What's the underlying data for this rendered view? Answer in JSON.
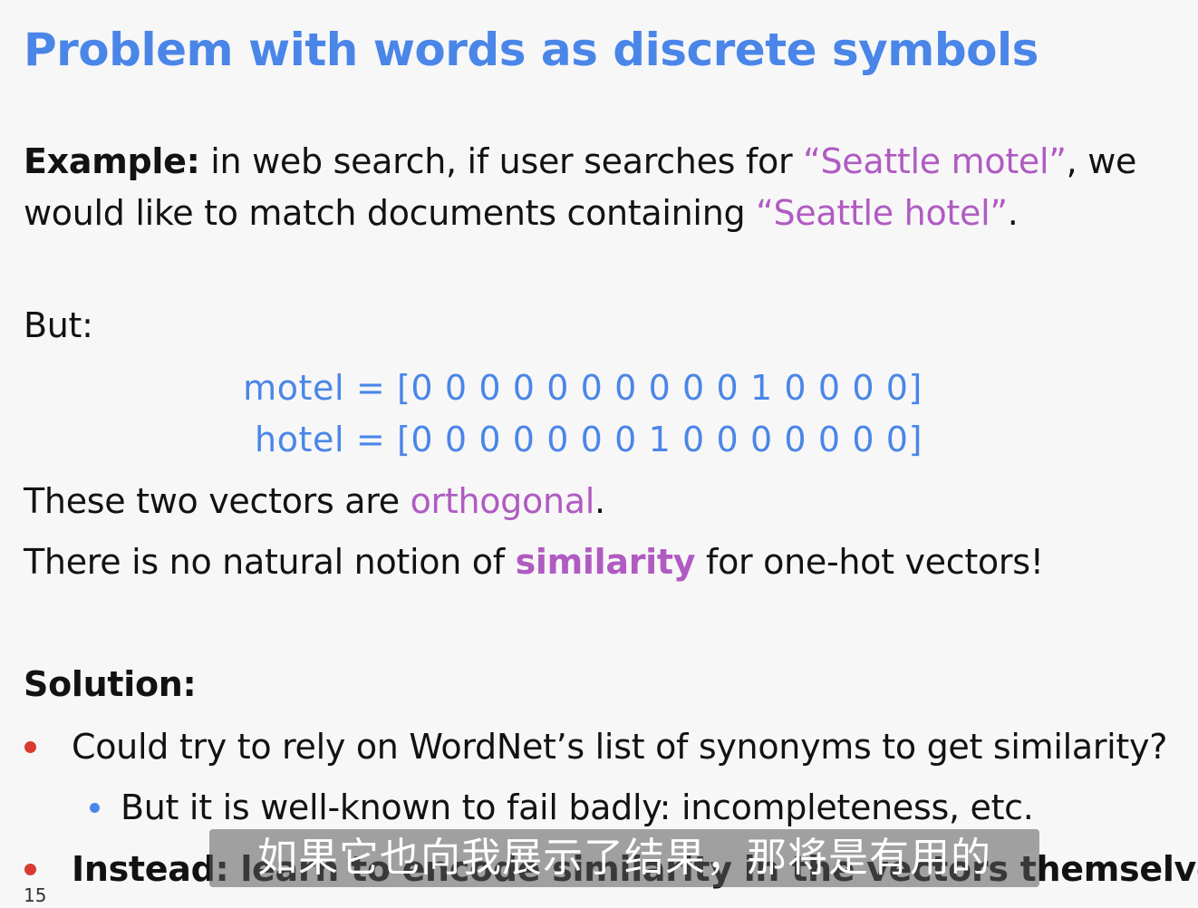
{
  "slide": {
    "title": "Problem with words as discrete symbols",
    "example": {
      "label": "Example:",
      "text_1": " in web search, if user searches for ",
      "quote_1": "“Seattle motel”",
      "text_2": ", we",
      "text_3": "would like to match documents containing ",
      "quote_2": "“Seattle hotel”",
      "text_4": "."
    },
    "but": "But:",
    "vectors": [
      "motel = [0 0 0 0 0 0 0 0 0 0 1 0 0 0 0]",
      "hotel = [0 0 0 0 0 0 0 1 0 0 0 0 0 0 0]"
    ],
    "orthogonal": {
      "text_1": "These two vectors are ",
      "highlight": "orthogonal",
      "text_2": "."
    },
    "similarity": {
      "text_1": "There is no natural notion of ",
      "highlight": "similarity",
      "text_2": " for one-hot vectors!"
    },
    "solution_heading": "Solution:",
    "bullets": [
      "Could try to rely on WordNet’s list of synonyms to get similarity?",
      "But it is well-known to fail badly: incompleteness, etc.",
      "Instead: learn to encode similarity in the vectors themselves"
    ],
    "slide_number": "15"
  },
  "subtitle": "如果它也向我展示了结果，那将是有用的",
  "colors": {
    "title": "#4a86e8",
    "highlight": "#b05bc2",
    "bullet_primary": "#d93a32",
    "bullet_secondary": "#4a86e8"
  }
}
